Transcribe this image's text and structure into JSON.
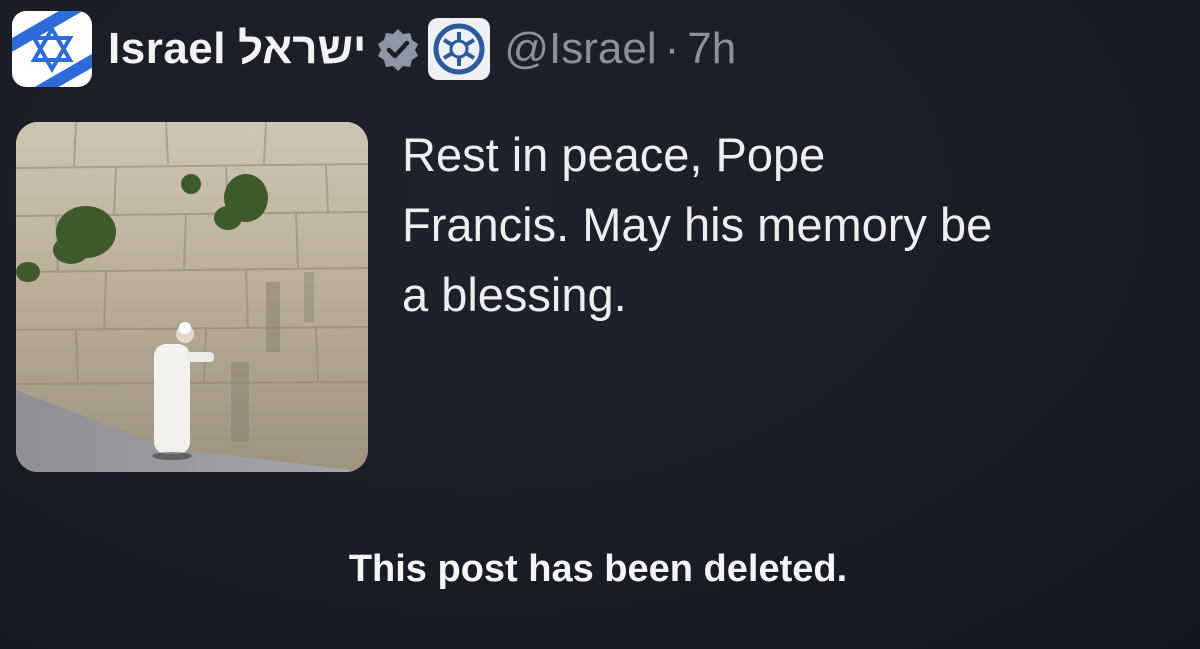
{
  "post": {
    "author": {
      "display_name": "Israel",
      "display_name_hebrew": "ישראל",
      "handle": "@Israel",
      "separator": "·",
      "time": "7h",
      "avatar_icon": "star-of-david-flag-icon",
      "verified_icon": "verified-badge-icon",
      "affiliation_icon": "government-emblem-icon"
    },
    "text": "Rest in peace, Pope\nFrancis. May his memory be\na blessing.",
    "media_icon": "western-wall-photo"
  },
  "notice": {
    "text": "This post has been deleted."
  },
  "colors": {
    "background": "#1a1d26",
    "text": "#e7e9ea",
    "muted": "#8b9198",
    "flag_blue": "#2d6bd8"
  }
}
